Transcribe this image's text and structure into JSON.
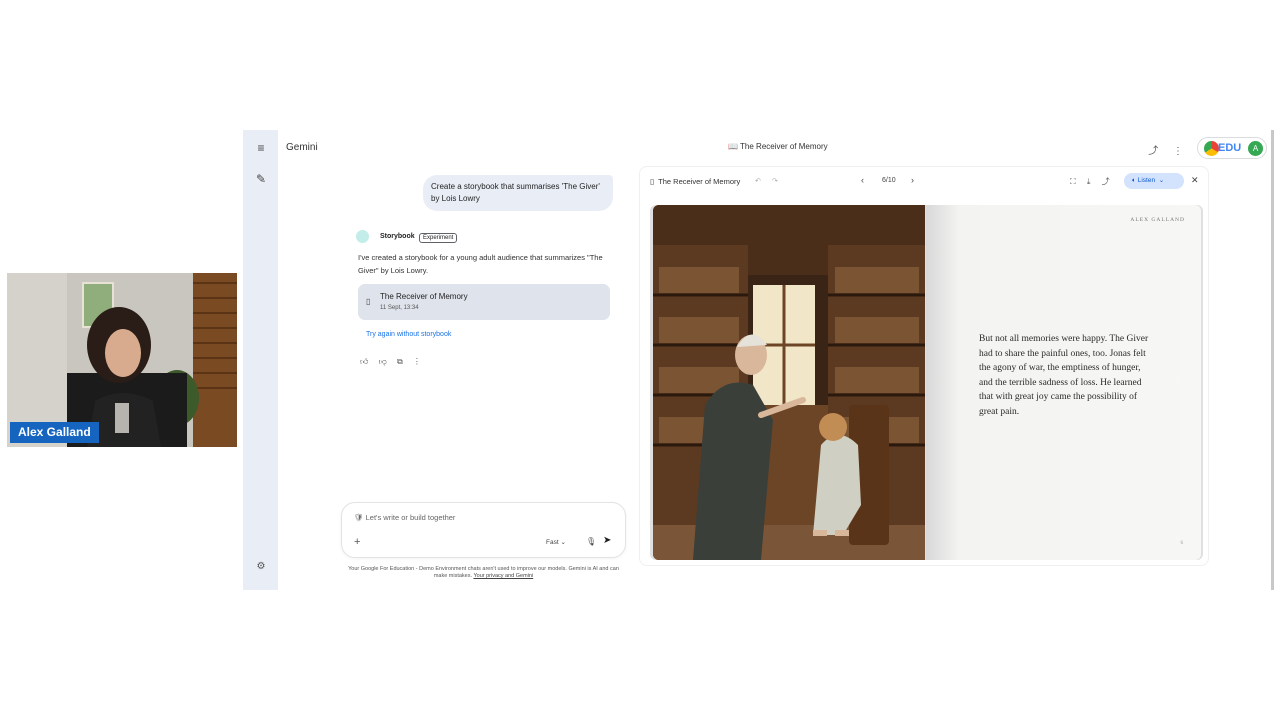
{
  "presenter": {
    "name": "Alex Galland"
  },
  "app": {
    "name": "Gemini",
    "header_title": "📖 The Receiver of Memory",
    "edu_badge": "EDU",
    "avatar_letter": "A"
  },
  "chat": {
    "user_prompt": "Create a storybook that summarises 'The Giver' by Lois Lowry",
    "agent_name": "Storybook",
    "agent_tag": "Experiment",
    "response": "I've created a storybook for a young adult audience that summarizes \"The Giver\" by Lois Lowry.",
    "card_title": "The Receiver of Memory",
    "card_date": "11 Sept, 13:34",
    "try_again": "Try again without storybook",
    "input_placeholder": "Let's write or build together",
    "model": "Fast",
    "disclaimer": "Your Google For Education - Demo Environment chats aren't used to improve our models. Gemini is AI and can make mistakes.",
    "privacy_link": "Your privacy and Gemini"
  },
  "book": {
    "title": "The Receiver of Memory",
    "page_indicator": "6/10",
    "listen_label": "Listen",
    "author": "ALEX GALLAND",
    "page_text": "But not all memories were happy. The Giver had to share the painful ones, too. Jonas felt the agony of war, the emptiness of hunger, and the terrible sadness of loss. He learned that with great joy came the possibility of great pain.",
    "page_number": "6"
  },
  "colors": {
    "accent": "#1a73e8",
    "listen_bg": "#d3e3fd",
    "rail": "#e9eef6",
    "name_tag": "#1565c0"
  }
}
